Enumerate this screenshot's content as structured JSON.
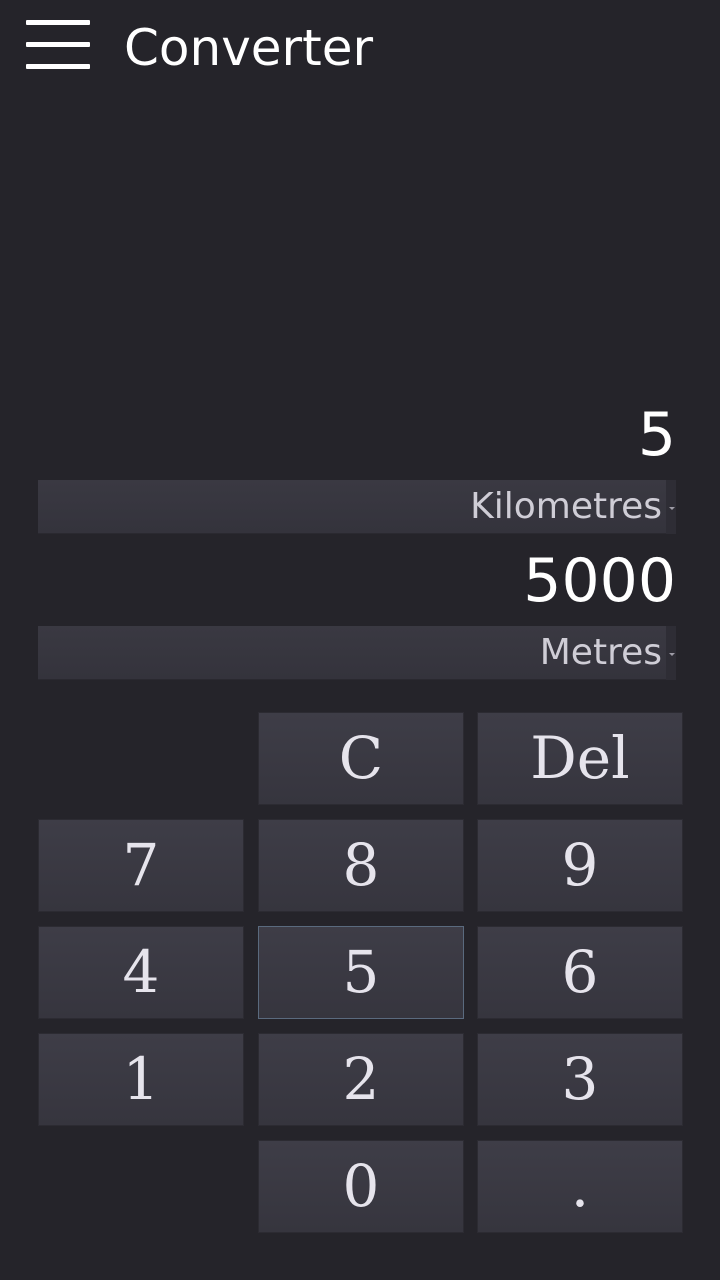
{
  "app_bar": {
    "title": "Converter",
    "menu_icon": "hamburger-menu-icon"
  },
  "converter": {
    "from_value": "5",
    "from_unit": "Kilometres",
    "to_value": "5000",
    "to_unit": "Metres"
  },
  "keypad": {
    "clear": "C",
    "delete": "Del",
    "k7": "7",
    "k8": "8",
    "k9": "9",
    "k4": "4",
    "k5": "5",
    "k6": "6",
    "k1": "1",
    "k2": "2",
    "k3": "3",
    "k0": "0",
    "dot": "."
  }
}
